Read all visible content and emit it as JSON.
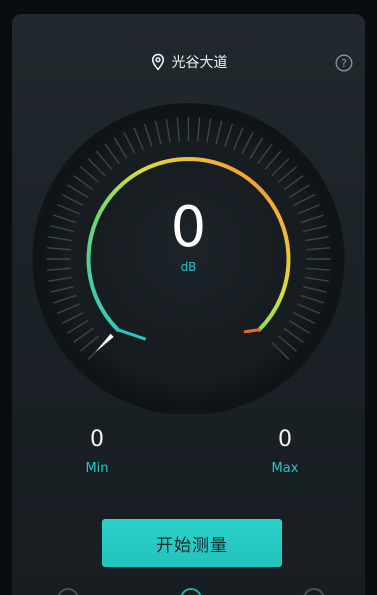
{
  "header": {
    "location": "光谷大道",
    "location_icon": "location-pin-icon",
    "help_icon": "question-mark-icon"
  },
  "gauge": {
    "reading": "0",
    "unit": "dB",
    "level": 0,
    "arc_colors": [
      "#28c5c9",
      "#7ed957",
      "#f3d23a",
      "#f29a2a",
      "#e8632a"
    ],
    "needle_color": "#ffffff"
  },
  "stats": {
    "min_value": "0",
    "min_label": "Min",
    "max_value": "0",
    "max_label": "Max"
  },
  "actions": {
    "start_label": "开始测量"
  },
  "accent_color": "#28c5c9"
}
